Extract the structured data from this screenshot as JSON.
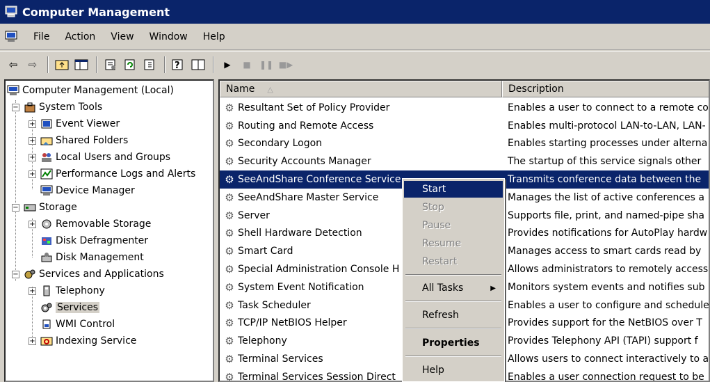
{
  "window": {
    "title": "Computer Management"
  },
  "menu": [
    "File",
    "Action",
    "View",
    "Window",
    "Help"
  ],
  "toolbar": {
    "icons": [
      "back-arrow-icon",
      "forward-arrow-icon",
      "up-folder-icon",
      "show-tree-icon",
      "properties-icon",
      "refresh-icon",
      "export-list-icon",
      "help-icon",
      "console-tree-icon",
      "start-service-icon",
      "stop-service-icon",
      "pause-service-icon",
      "restart-service-icon"
    ]
  },
  "tree": {
    "root": "Computer Management (Local)",
    "system_tools": "System Tools",
    "event_viewer": "Event Viewer",
    "shared_folders": "Shared Folders",
    "local_users": "Local Users and Groups",
    "perf_logs": "Performance Logs and Alerts",
    "device_manager": "Device Manager",
    "storage": "Storage",
    "removable_storage": "Removable Storage",
    "disk_defrag": "Disk Defragmenter",
    "disk_mgmt": "Disk Management",
    "services_apps": "Services and Applications",
    "telephony": "Telephony",
    "services": "Services",
    "wmi": "WMI Control",
    "indexing": "Indexing Service"
  },
  "list": {
    "columns": [
      "Name",
      "Description"
    ],
    "rows": [
      {
        "name": "Resultant Set of Policy Provider",
        "desc": "Enables a user to connect to a remote co"
      },
      {
        "name": "Routing and Remote Access",
        "desc": "Enables multi-protocol LAN-to-LAN, LAN-"
      },
      {
        "name": "Secondary Logon",
        "desc": "Enables starting processes under alterna"
      },
      {
        "name": "Security Accounts Manager",
        "desc": "The startup of this service signals other"
      },
      {
        "name": "SeeAndShare Conference Service",
        "desc": "Transmits conference data between the"
      },
      {
        "name": "SeeAndShare Master Service",
        "desc": "Manages the list of active conferences a"
      },
      {
        "name": "Server",
        "desc": "Supports file, print, and named-pipe sha"
      },
      {
        "name": "Shell Hardware Detection",
        "desc": "Provides notifications for AutoPlay hardw"
      },
      {
        "name": "Smart Card",
        "desc": "Manages access to smart cards read by"
      },
      {
        "name": "Special Administration Console H",
        "desc": "Allows administrators to remotely access"
      },
      {
        "name": "System Event Notification",
        "desc": "Monitors system events and notifies sub"
      },
      {
        "name": "Task Scheduler",
        "desc": "Enables a user to configure and schedule"
      },
      {
        "name": "TCP/IP NetBIOS Helper",
        "desc": "Provides support for the NetBIOS over T"
      },
      {
        "name": "Telephony",
        "desc": "Provides Telephony API (TAPI) support f"
      },
      {
        "name": "Terminal Services",
        "desc": "Allows users to connect interactively to a"
      },
      {
        "name": "Terminal Services Session Direct",
        "desc": "Enables a user connection request to be"
      }
    ]
  },
  "context_menu": {
    "start": "Start",
    "stop": "Stop",
    "pause": "Pause",
    "resume": "Resume",
    "restart": "Restart",
    "all_tasks": "All Tasks",
    "refresh": "Refresh",
    "properties": "Properties",
    "help": "Help"
  },
  "colors": {
    "selection": "#0a246a",
    "chrome": "#d4d0c8"
  }
}
